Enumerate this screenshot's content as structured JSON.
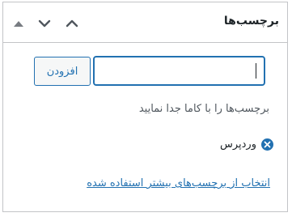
{
  "box": {
    "title": "برچسب‌ها",
    "controls": [
      "move-up",
      "move-down",
      "toggle-panel"
    ]
  },
  "tag_input": {
    "value": "",
    "placeholder": ""
  },
  "add_button": {
    "label": "افزودن"
  },
  "hint": "برچسب‌ها را با کاما جدا نمایید",
  "tags": [
    {
      "label": "وردپرس",
      "remove_icon": "remove-circle-icon"
    }
  ],
  "choose_link": "انتخاب از برچسب‌های بیشتر استفاده شده",
  "colors": {
    "accent": "#2271b1",
    "border": "#c3c4c7",
    "text": "#1d2327",
    "hint": "#50575e",
    "arrows": "#50575e"
  }
}
